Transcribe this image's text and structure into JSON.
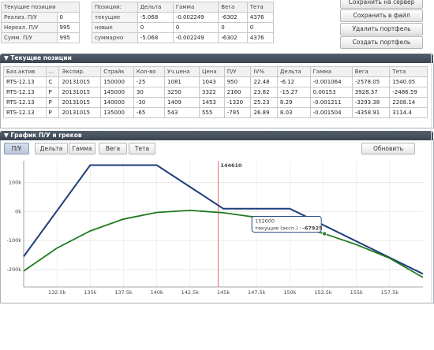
{
  "summary_left": {
    "header": "Текущие позиции",
    "rows": [
      {
        "label": "Реализ. П/У",
        "value": "0"
      },
      {
        "label": "Нереал. П/У",
        "value": "995"
      },
      {
        "label": "Сумм. П/У",
        "value": "995"
      }
    ]
  },
  "summary_mid": {
    "headers": [
      "Позиции:",
      "Дельта",
      "Гамма",
      "Вега",
      "Тета"
    ],
    "rows": [
      [
        "текущие",
        "-5.068",
        "-0.002249",
        "-6302",
        "4376"
      ],
      [
        "новые",
        "0",
        "0",
        "0",
        "0"
      ],
      [
        "суммарно",
        "-5.068",
        "-0.002249",
        "-6302",
        "4376"
      ]
    ]
  },
  "buttons": {
    "save_server": "Сохранить на сервер",
    "save_file": "Сохранить в файл",
    "delete_portfolio": "Удалить портфель",
    "create_portfolio": "Создать портфель",
    "refresh": "Обновить"
  },
  "positions": {
    "title": "▼ Текущие позиции",
    "columns": [
      "Баз.актив",
      "...",
      "Экспир.",
      "Страйк",
      "Кол-во",
      "Уч.цена",
      "Цена",
      "П/У",
      "IV%",
      "Дельта",
      "Гамма",
      "Вега",
      "Тета"
    ],
    "rows": [
      [
        "RTS-12.13",
        "C",
        "20131015",
        "150000",
        "-25",
        "1081",
        "1043",
        "950",
        "22.48",
        "-6.12",
        "-0.001064",
        "-2578.05",
        "1540.05"
      ],
      [
        "RTS-12.13",
        "P",
        "20131015",
        "145000",
        "30",
        "3250",
        "3322",
        "2160",
        "23.82",
        "-15.27",
        "0.00153",
        "3928.37",
        "-2486.59"
      ],
      [
        "RTS-12.13",
        "P",
        "20131015",
        "140000",
        "-30",
        "1409",
        "1453",
        "-1320",
        "25.23",
        "8.29",
        "-0.001211",
        "-3293.38",
        "2208.14"
      ],
      [
        "RTS-12.13",
        "P",
        "20131015",
        "135000",
        "-65",
        "543",
        "555",
        "-795",
        "26.89",
        "8.03",
        "-0.001504",
        "-4358.91",
        "3114.4"
      ]
    ]
  },
  "chart_panel": {
    "title": "▼ График П/У и греков",
    "tabs": [
      "П/У",
      "Дельта",
      "Гамма",
      "Вега",
      "Тета"
    ],
    "active_tab": "П/У"
  },
  "chart_data": {
    "type": "line",
    "x_ticks": [
      "132.5k",
      "135k",
      "137.5k",
      "140k",
      "142.5k",
      "145k",
      "147.5k",
      "150k",
      "152.5k",
      "155k",
      "157.5k"
    ],
    "x_tick_values": [
      132500,
      135000,
      137500,
      140000,
      142500,
      145000,
      147500,
      150000,
      152500,
      155000,
      157500
    ],
    "y_ticks": [
      "100k",
      "0k",
      "-100k",
      "-200k"
    ],
    "y_tick_values": [
      100000,
      0,
      -100000,
      -200000
    ],
    "xlim": [
      130000,
      160000
    ],
    "ylim": [
      -260000,
      175000
    ],
    "current_price": 144610,
    "current_price_label": "144610",
    "series": [
      {
        "color": "#1f3f7a",
        "x": [
          130000,
          135000,
          140000,
          145000,
          150000,
          160000
        ],
        "y": [
          -155000,
          160000,
          160000,
          10000,
          10000,
          -215000
        ]
      },
      {
        "color": "#1f7a1f",
        "x": [
          130000,
          132500,
          135000,
          137500,
          140000,
          142500,
          145000,
          147500,
          150000,
          152500,
          155000,
          157500,
          160000
        ],
        "y": [
          -205000,
          -126000,
          -67000,
          -26000,
          -3000,
          4000,
          -4000,
          -20000,
          -44000,
          -75000,
          -114000,
          -161000,
          -227000
        ]
      }
    ],
    "tooltip": {
      "x": 152600,
      "x_label": "152600",
      "label": "текущие (эксп.) :",
      "value": "-67925"
    }
  }
}
